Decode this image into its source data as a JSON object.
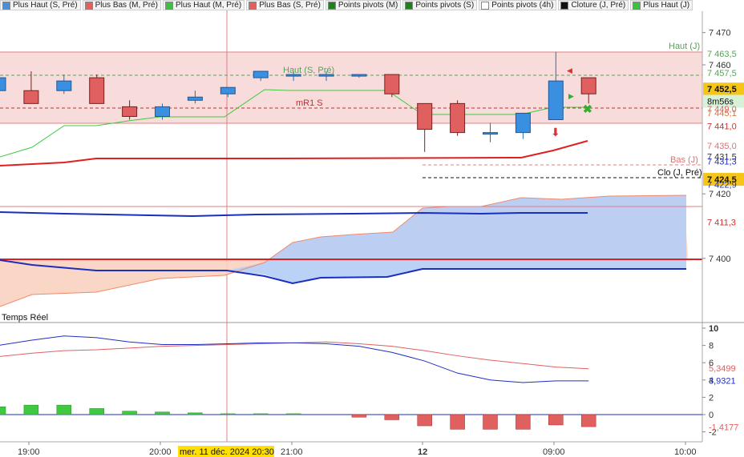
{
  "legend": [
    {
      "label": "Plus Haut (S, Pré)",
      "color": "#4a8fd8"
    },
    {
      "label": "Plus Bas (M, Pré)",
      "color": "#e06060"
    },
    {
      "label": "Plus Haut (M, Pré)",
      "color": "#40c040"
    },
    {
      "label": "Plus Bas (S, Pré)",
      "color": "#e06060"
    },
    {
      "label": "Points pivots (M)",
      "color": "#208020"
    },
    {
      "label": "Points pivots (S)",
      "color": "#208020"
    },
    {
      "label": "Points pivots (4h)",
      "color": "#ffffff"
    },
    {
      "label": "Cloture (J, Pré)",
      "color": "#111111"
    },
    {
      "label": "Plus Haut (J)",
      "color": "#40c040"
    }
  ],
  "price_axis": {
    "ticks": [
      "7 470",
      "7 460",
      "7 420",
      "7 400"
    ]
  },
  "price_tags": [
    {
      "text": "7 463,5",
      "color": "#5aa05a",
      "bg": "none",
      "value": 7463.5
    },
    {
      "text": "7 457,5",
      "color": "#5aa05a",
      "bg": "none",
      "value": 7457.5
    },
    {
      "text": "7 452,5",
      "color": "#111111",
      "bg": "#f5c518",
      "value": 7452.5
    },
    {
      "text": "8m56s",
      "color": "#111111",
      "bg": "#d7f2d7",
      "value": 7448.7
    },
    {
      "text": "7 449,0",
      "color": "#e06060",
      "bg": "none",
      "value": 7446.3
    },
    {
      "text": "7 445,1",
      "color": "#e07040",
      "bg": "none",
      "value": 7445.1
    },
    {
      "text": "7 441,0",
      "color": "#d03030",
      "bg": "none",
      "value": 7441.0
    },
    {
      "text": "7 435,0",
      "color": "#e07070",
      "bg": "none",
      "value": 7435.0
    },
    {
      "text": "7 431,5",
      "color": "#333333",
      "bg": "none",
      "value": 7431.6
    },
    {
      "text": "7 431,3",
      "color": "#2030c0",
      "bg": "none",
      "value": 7430.1
    },
    {
      "text": "7 424,5",
      "color": "#111111",
      "bg": "#f5c518",
      "value": 7424.5
    },
    {
      "text": "7 422,9",
      "color": "#2030c0",
      "bg": "none",
      "value": 7422.9
    },
    {
      "text": "7 411,3",
      "color": "#d03030",
      "bg": "none",
      "value": 7411.3
    }
  ],
  "chart_labels": {
    "haut_j": "Haut (J)",
    "haut_s_pre": "Haut (S, Pré)",
    "mr1_s": "mR1 S",
    "bas_j": "Bas (J)",
    "clo_j_pre": "Clo (J, Pré)",
    "temps_reel": "Temps Réel"
  },
  "osc_axis": {
    "ticks": [
      "10",
      "8",
      "6",
      "4",
      "2",
      "0",
      "-2"
    ]
  },
  "osc_tags": [
    {
      "text": "5,3499",
      "color": "#e06060",
      "value": 5.35
    },
    {
      "text": "3,9321",
      "color": "#2030c0",
      "value": 3.93
    },
    {
      "text": "-1,4177",
      "color": "#e06060",
      "value": -1.42
    }
  ],
  "time_axis": {
    "labels": [
      "19:00",
      "20:00",
      "21:00",
      "12",
      "09:00",
      "10:00"
    ]
  },
  "crosshair_label": "mer. 11 déc. 2024 20:30",
  "chart_data": {
    "type": "candlestick",
    "candles": [
      {
        "o": 7452,
        "h": 7458,
        "l": 7446,
        "c": 7456
      },
      {
        "o": 7452,
        "h": 7458,
        "l": 7448,
        "c": 7448
      },
      {
        "o": 7452,
        "h": 7457,
        "l": 7451,
        "c": 7455
      },
      {
        "o": 7456,
        "h": 7457,
        "l": 7448,
        "c": 7448
      },
      {
        "o": 7447,
        "h": 7449,
        "l": 7443,
        "c": 7444
      },
      {
        "o": 7444,
        "h": 7448,
        "l": 7443,
        "c": 7447
      },
      {
        "o": 7449,
        "h": 7452,
        "l": 7448,
        "c": 7450
      },
      {
        "o": 7451,
        "h": 7453,
        "l": 7450,
        "c": 7453
      },
      {
        "o": 7456,
        "h": 7458,
        "l": 7455,
        "c": 7458
      },
      {
        "o": 7457,
        "h": 7458,
        "l": 7455,
        "c": 7457
      },
      {
        "o": 7457,
        "h": 7458,
        "l": 7455,
        "c": 7457
      },
      {
        "o": 7457,
        "h": 7457,
        "l": 7456,
        "c": 7457
      },
      {
        "o": 7457,
        "h": 7457,
        "l": 7450,
        "c": 7451
      },
      {
        "o": 7448,
        "h": 7448,
        "l": 7433,
        "c": 7440
      },
      {
        "o": 7448,
        "h": 7449,
        "l": 7438,
        "c": 7439
      },
      {
        "o": 7439,
        "h": 7442,
        "l": 7436,
        "c": 7439
      },
      {
        "o": 7439,
        "h": 7442,
        "l": 7437,
        "c": 7445
      },
      {
        "o": 7443,
        "h": 7464,
        "l": 7443,
        "c": 7455
      },
      {
        "o": 7456,
        "h": 7456,
        "l": 7448,
        "c": 7451
      }
    ],
    "series": [
      {
        "name": "mR1 S",
        "values": [
          7446.3
        ]
      },
      {
        "name": "Haut (J)",
        "values": [
          7463.5
        ]
      },
      {
        "name": "Bas (J)",
        "values": [
          7435.0
        ]
      },
      {
        "name": "Clo (J, Pré)",
        "values": [
          7431.6
        ]
      }
    ],
    "oscillator": {
      "blue": [
        8.0,
        8.6,
        9.1,
        8.9,
        8.4,
        8.1,
        8.1,
        8.2,
        8.3,
        8.3,
        8.2,
        7.9,
        7.2,
        6.2,
        4.8,
        4.0,
        3.7,
        3.9,
        3.9
      ],
      "red": [
        6.7,
        7.1,
        7.4,
        7.5,
        7.7,
        7.9,
        8.0,
        8.1,
        8.2,
        8.3,
        8.4,
        8.2,
        7.9,
        7.4,
        6.8,
        6.3,
        5.9,
        5.5,
        5.3
      ],
      "histogram": [
        0.9,
        1.1,
        1.1,
        0.7,
        0.4,
        0.3,
        0.2,
        0.1,
        0.1,
        0.1,
        0.0,
        -0.3,
        -0.6,
        -1.3,
        -1.7,
        -1.7,
        -1.7,
        -1.2,
        -1.4
      ]
    }
  }
}
